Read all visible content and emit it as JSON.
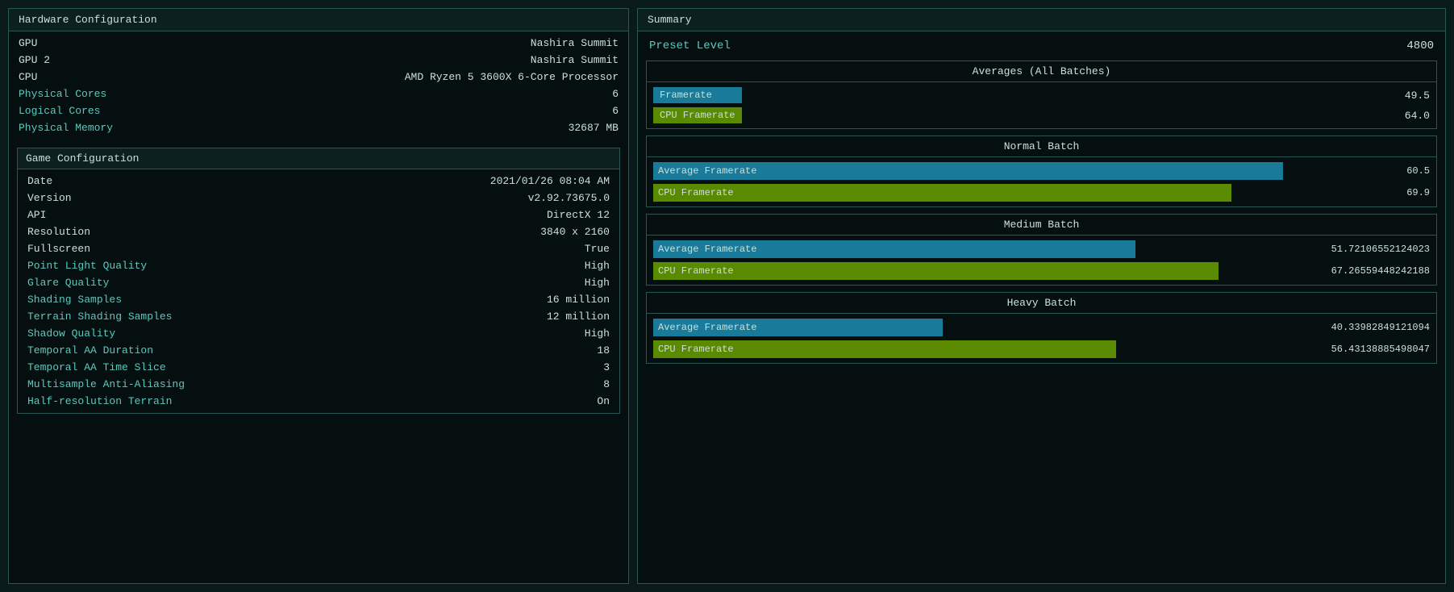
{
  "leftPanel": {
    "title": "Hardware Configuration",
    "hardware": {
      "rows": [
        {
          "label": "GPU",
          "value": "Nashira Summit",
          "labelStyle": "white"
        },
        {
          "label": "GPU 2",
          "value": "Nashira Summit",
          "labelStyle": "white"
        },
        {
          "label": "CPU",
          "value": "AMD Ryzen 5 3600X 6-Core Processor",
          "labelStyle": "white"
        },
        {
          "label": "Physical Cores",
          "value": "6",
          "labelStyle": "cyan"
        },
        {
          "label": "Logical Cores",
          "value": "6",
          "labelStyle": "cyan"
        },
        {
          "label": "Physical Memory",
          "value": "32687 MB",
          "labelStyle": "cyan"
        }
      ]
    },
    "gameConfig": {
      "title": "Game Configuration",
      "rows": [
        {
          "label": "Date",
          "value": "2021/01/26 08:04 AM",
          "labelStyle": "white"
        },
        {
          "label": "Version",
          "value": "v2.92.73675.0",
          "labelStyle": "white"
        },
        {
          "label": "API",
          "value": "DirectX 12",
          "labelStyle": "white"
        },
        {
          "label": "Resolution",
          "value": "3840 x 2160",
          "labelStyle": "white"
        },
        {
          "label": "Fullscreen",
          "value": "True",
          "labelStyle": "white"
        },
        {
          "label": "Point Light Quality",
          "value": "High",
          "labelStyle": "cyan"
        },
        {
          "label": "Glare Quality",
          "value": "High",
          "labelStyle": "cyan"
        },
        {
          "label": "Shading Samples",
          "value": "16 million",
          "labelStyle": "cyan"
        },
        {
          "label": "Terrain Shading Samples",
          "value": "12 million",
          "labelStyle": "cyan"
        },
        {
          "label": "Shadow Quality",
          "value": "High",
          "labelStyle": "cyan"
        },
        {
          "label": "Temporal AA Duration",
          "value": "18",
          "labelStyle": "cyan"
        },
        {
          "label": "Temporal AA Time Slice",
          "value": "3",
          "labelStyle": "cyan"
        },
        {
          "label": "Multisample Anti-Aliasing",
          "value": "8",
          "labelStyle": "cyan"
        },
        {
          "label": "Half-resolution Terrain",
          "value": "On",
          "labelStyle": "cyan"
        }
      ]
    }
  },
  "rightPanel": {
    "title": "Summary",
    "presetLabel": "Preset Level",
    "presetValue": "4800",
    "averages": {
      "title": "Averages (All Batches)",
      "framerate": {
        "label": "Framerate",
        "value": "49.5"
      },
      "cpu": {
        "label": "CPU Framerate",
        "value": "64.0"
      }
    },
    "normalBatch": {
      "title": "Normal Batch",
      "avgFramerate": {
        "label": "Average Framerate",
        "value": "60.5",
        "barWidth": "98"
      },
      "cpuFramerate": {
        "label": "CPU Framerate",
        "value": "69.9",
        "barWidth": "90"
      }
    },
    "mediumBatch": {
      "title": "Medium Batch",
      "avgFramerate": {
        "label": "Average Framerate",
        "value": "51.72106552124023",
        "barWidth": "75"
      },
      "cpuFramerate": {
        "label": "CPU Framerate",
        "value": "67.26559448242188",
        "barWidth": "88"
      }
    },
    "heavyBatch": {
      "title": "Heavy Batch",
      "avgFramerate": {
        "label": "Average Framerate",
        "value": "40.33982849121094",
        "barWidth": "45"
      },
      "cpuFramerate": {
        "label": "CPU Framerate",
        "value": "56.43138885498047",
        "barWidth": "72"
      }
    }
  }
}
